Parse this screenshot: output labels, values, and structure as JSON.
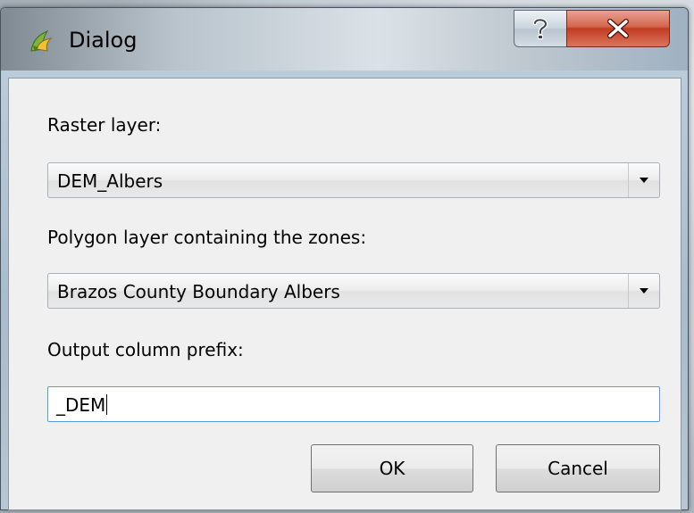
{
  "window": {
    "title": "Dialog"
  },
  "form": {
    "raster_label": "Raster layer:",
    "raster_value": "DEM_Albers",
    "polygon_label": "Polygon layer containing the zones:",
    "polygon_value": "Brazos County Boundary Albers",
    "prefix_label": "Output column prefix:",
    "prefix_value": "_DEM"
  },
  "buttons": {
    "ok_label": "OK",
    "cancel_label": "Cancel"
  },
  "icons": {
    "app": "qgis-icon",
    "help": "question-mark-icon",
    "close": "close-x-icon",
    "dropdown": "dropdown-arrow-icon"
  },
  "colors": {
    "close_button": "#c23c22",
    "focus_border": "#569de5",
    "client_background": "#f0f0f0"
  }
}
